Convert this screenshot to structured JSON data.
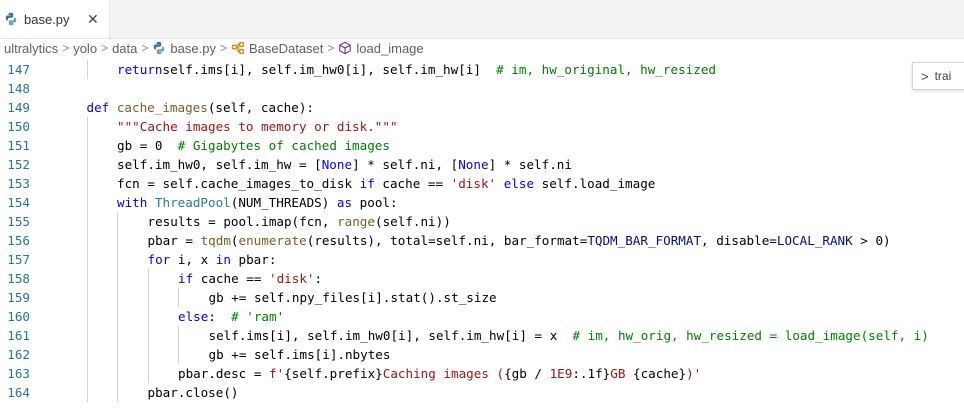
{
  "tab": {
    "label": "base.py",
    "close_symbol": "✕",
    "icon": "python-file-icon"
  },
  "breadcrumb": {
    "items": [
      "ultralytics",
      "yolo",
      "data",
      "base.py",
      "BaseDataset",
      "load_image"
    ],
    "separator": ">"
  },
  "side_widget": {
    "label": "trai",
    "chevron": ">"
  },
  "editor": {
    "lines": [
      {
        "n": "147",
        "indent": 2,
        "segs": [
          [
            "k",
            "return"
          ],
          [
            "",
            "self.ims[i], self.im_hw0[i], self.im_hw[i]  "
          ],
          [
            "c",
            "# im, hw_original, hw_resized"
          ]
        ]
      },
      {
        "n": "148",
        "indent": 0,
        "segs": []
      },
      {
        "n": "149",
        "indent": 1,
        "segs": [
          [
            "k",
            "def "
          ],
          [
            "f",
            "cache_images"
          ],
          [
            "",
            "(self, cache):"
          ]
        ]
      },
      {
        "n": "150",
        "indent": 2,
        "segs": [
          [
            "s",
            "\"\"\"Cache images to memory or disk.\"\"\""
          ]
        ]
      },
      {
        "n": "151",
        "indent": 2,
        "segs": [
          [
            "",
            "gb = 0  "
          ],
          [
            "c",
            "# Gigabytes of cached images"
          ]
        ]
      },
      {
        "n": "152",
        "indent": 2,
        "segs": [
          [
            "",
            "self.im_hw0, self.im_hw = ["
          ],
          [
            "k",
            "None"
          ],
          [
            "",
            "] * self.ni, ["
          ],
          [
            "k",
            "None"
          ],
          [
            "",
            "] * self.ni"
          ]
        ]
      },
      {
        "n": "153",
        "indent": 2,
        "segs": [
          [
            "",
            "fcn = self.cache_images_to_disk "
          ],
          [
            "k",
            "if"
          ],
          [
            "",
            " cache == "
          ],
          [
            "s",
            "'disk'"
          ],
          [
            "k",
            " else"
          ],
          [
            "",
            " self.load_image"
          ]
        ]
      },
      {
        "n": "154",
        "indent": 2,
        "segs": [
          [
            "k",
            "with "
          ],
          [
            "t",
            "ThreadPool"
          ],
          [
            "",
            "(NUM_THREADS) "
          ],
          [
            "k",
            "as"
          ],
          [
            "",
            " pool:"
          ]
        ]
      },
      {
        "n": "155",
        "indent": 3,
        "segs": [
          [
            "",
            "results = pool.imap(fcn, "
          ],
          [
            "f",
            "range"
          ],
          [
            "",
            "(self.ni))"
          ]
        ]
      },
      {
        "n": "156",
        "indent": 3,
        "segs": [
          [
            "",
            "pbar = "
          ],
          [
            "f",
            "tqdm"
          ],
          [
            "",
            "("
          ],
          [
            "f",
            "enumerate"
          ],
          [
            "",
            "(results), total=self.ni, bar_format="
          ],
          [
            "n",
            "TQDM_BAR_FORMAT"
          ],
          [
            "",
            ", disable="
          ],
          [
            "n",
            "LOCAL_RANK"
          ],
          [
            "",
            " > 0)"
          ]
        ]
      },
      {
        "n": "157",
        "indent": 3,
        "segs": [
          [
            "k",
            "for"
          ],
          [
            "",
            " i, x "
          ],
          [
            "k",
            "in"
          ],
          [
            "",
            " pbar:"
          ]
        ]
      },
      {
        "n": "158",
        "indent": 4,
        "segs": [
          [
            "k",
            "if"
          ],
          [
            "",
            " cache == "
          ],
          [
            "s",
            "'disk'"
          ],
          [
            "",
            ":"
          ]
        ]
      },
      {
        "n": "159",
        "indent": 5,
        "segs": [
          [
            "",
            "gb += self.npy_files[i].stat().st_size"
          ]
        ]
      },
      {
        "n": "160",
        "indent": 4,
        "segs": [
          [
            "k",
            "else"
          ],
          [
            "",
            ":  "
          ],
          [
            "c",
            "# 'ram'"
          ]
        ]
      },
      {
        "n": "161",
        "indent": 5,
        "segs": [
          [
            "",
            "self.ims[i], self.im_hw0[i], self.im_hw[i] = x  "
          ],
          [
            "c",
            "# im, hw_orig, hw_resized = load_image(self, i)"
          ]
        ]
      },
      {
        "n": "162",
        "indent": 5,
        "segs": [
          [
            "",
            "gb += self.ims[i].nbytes"
          ]
        ]
      },
      {
        "n": "163",
        "indent": 4,
        "segs": [
          [
            "",
            "pbar.desc = "
          ],
          [
            "s",
            "f'"
          ],
          [
            "",
            "{self.prefix}"
          ],
          [
            "s",
            "Caching images ("
          ],
          [
            "",
            "{gb / "
          ],
          [
            "s",
            "1E9"
          ],
          [
            "",
            ":.1f}"
          ],
          [
            "s",
            "GB "
          ],
          [
            "",
            "{cache}"
          ],
          [
            "s",
            ")'"
          ]
        ]
      },
      {
        "n": "164",
        "indent": 3,
        "segs": [
          [
            "",
            "pbar.close()"
          ]
        ]
      }
    ]
  }
}
